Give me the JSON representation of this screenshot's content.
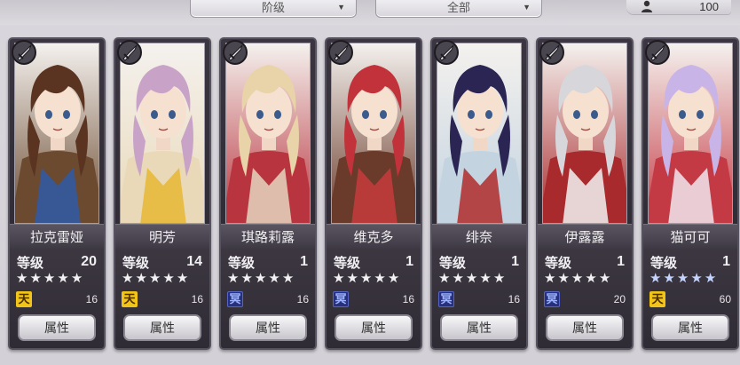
{
  "filters": {
    "rank_label": "阶级",
    "all_label": "全部"
  },
  "roster": {
    "count": "100"
  },
  "characters": [
    {
      "name": "拉克雷娅",
      "level_label": "等级",
      "level": "20",
      "stars": 5,
      "badge": "天",
      "badge_style": "gold",
      "badge_value": "16",
      "attr_label": "属性",
      "theme": "#6b4a30",
      "accent": "#2e5aa6",
      "hair": "#5a3420"
    },
    {
      "name": "明芳",
      "level_label": "等级",
      "level": "14",
      "stars": 5,
      "badge": "天",
      "badge_style": "gold",
      "badge_value": "16",
      "attr_label": "属性",
      "theme": "#e9d9b8",
      "accent": "#e6b733",
      "hair": "#c9a3c7"
    },
    {
      "name": "琪路莉露",
      "level_label": "等级",
      "level": "1",
      "stars": 5,
      "badge": "冥",
      "badge_style": "blue",
      "badge_value": "16",
      "attr_label": "属性",
      "theme": "#b8343e",
      "accent": "#e5d6c0",
      "hair": "#e8d4a8"
    },
    {
      "name": "维克多",
      "level_label": "等级",
      "level": "1",
      "stars": 5,
      "badge": "冥",
      "badge_style": "blue",
      "badge_value": "16",
      "attr_label": "属性",
      "theme": "#6a3a2a",
      "accent": "#c53b3c",
      "hair": "#c2323a"
    },
    {
      "name": "绯奈",
      "level_label": "等级",
      "level": "1",
      "stars": 5,
      "badge": "冥",
      "badge_style": "blue",
      "badge_value": "16",
      "attr_label": "属性",
      "theme": "#c3d3e0",
      "accent": "#b22b2b",
      "hair": "#2a2552"
    },
    {
      "name": "伊露露",
      "level_label": "等级",
      "level": "1",
      "stars": 5,
      "badge": "冥",
      "badge_style": "blue",
      "badge_value": "20",
      "attr_label": "属性",
      "theme": "#a82a2d",
      "accent": "#f2f2f2",
      "hair": "#d7d7db"
    },
    {
      "name": "猫可可",
      "level_label": "等级",
      "level": "1",
      "stars": 5,
      "star_style": "blue",
      "badge": "天",
      "badge_style": "gold",
      "badge_value": "60",
      "attr_label": "属性",
      "theme": "#c43a44",
      "accent": "#f1e6ef",
      "hair": "#c8b4e6"
    }
  ]
}
